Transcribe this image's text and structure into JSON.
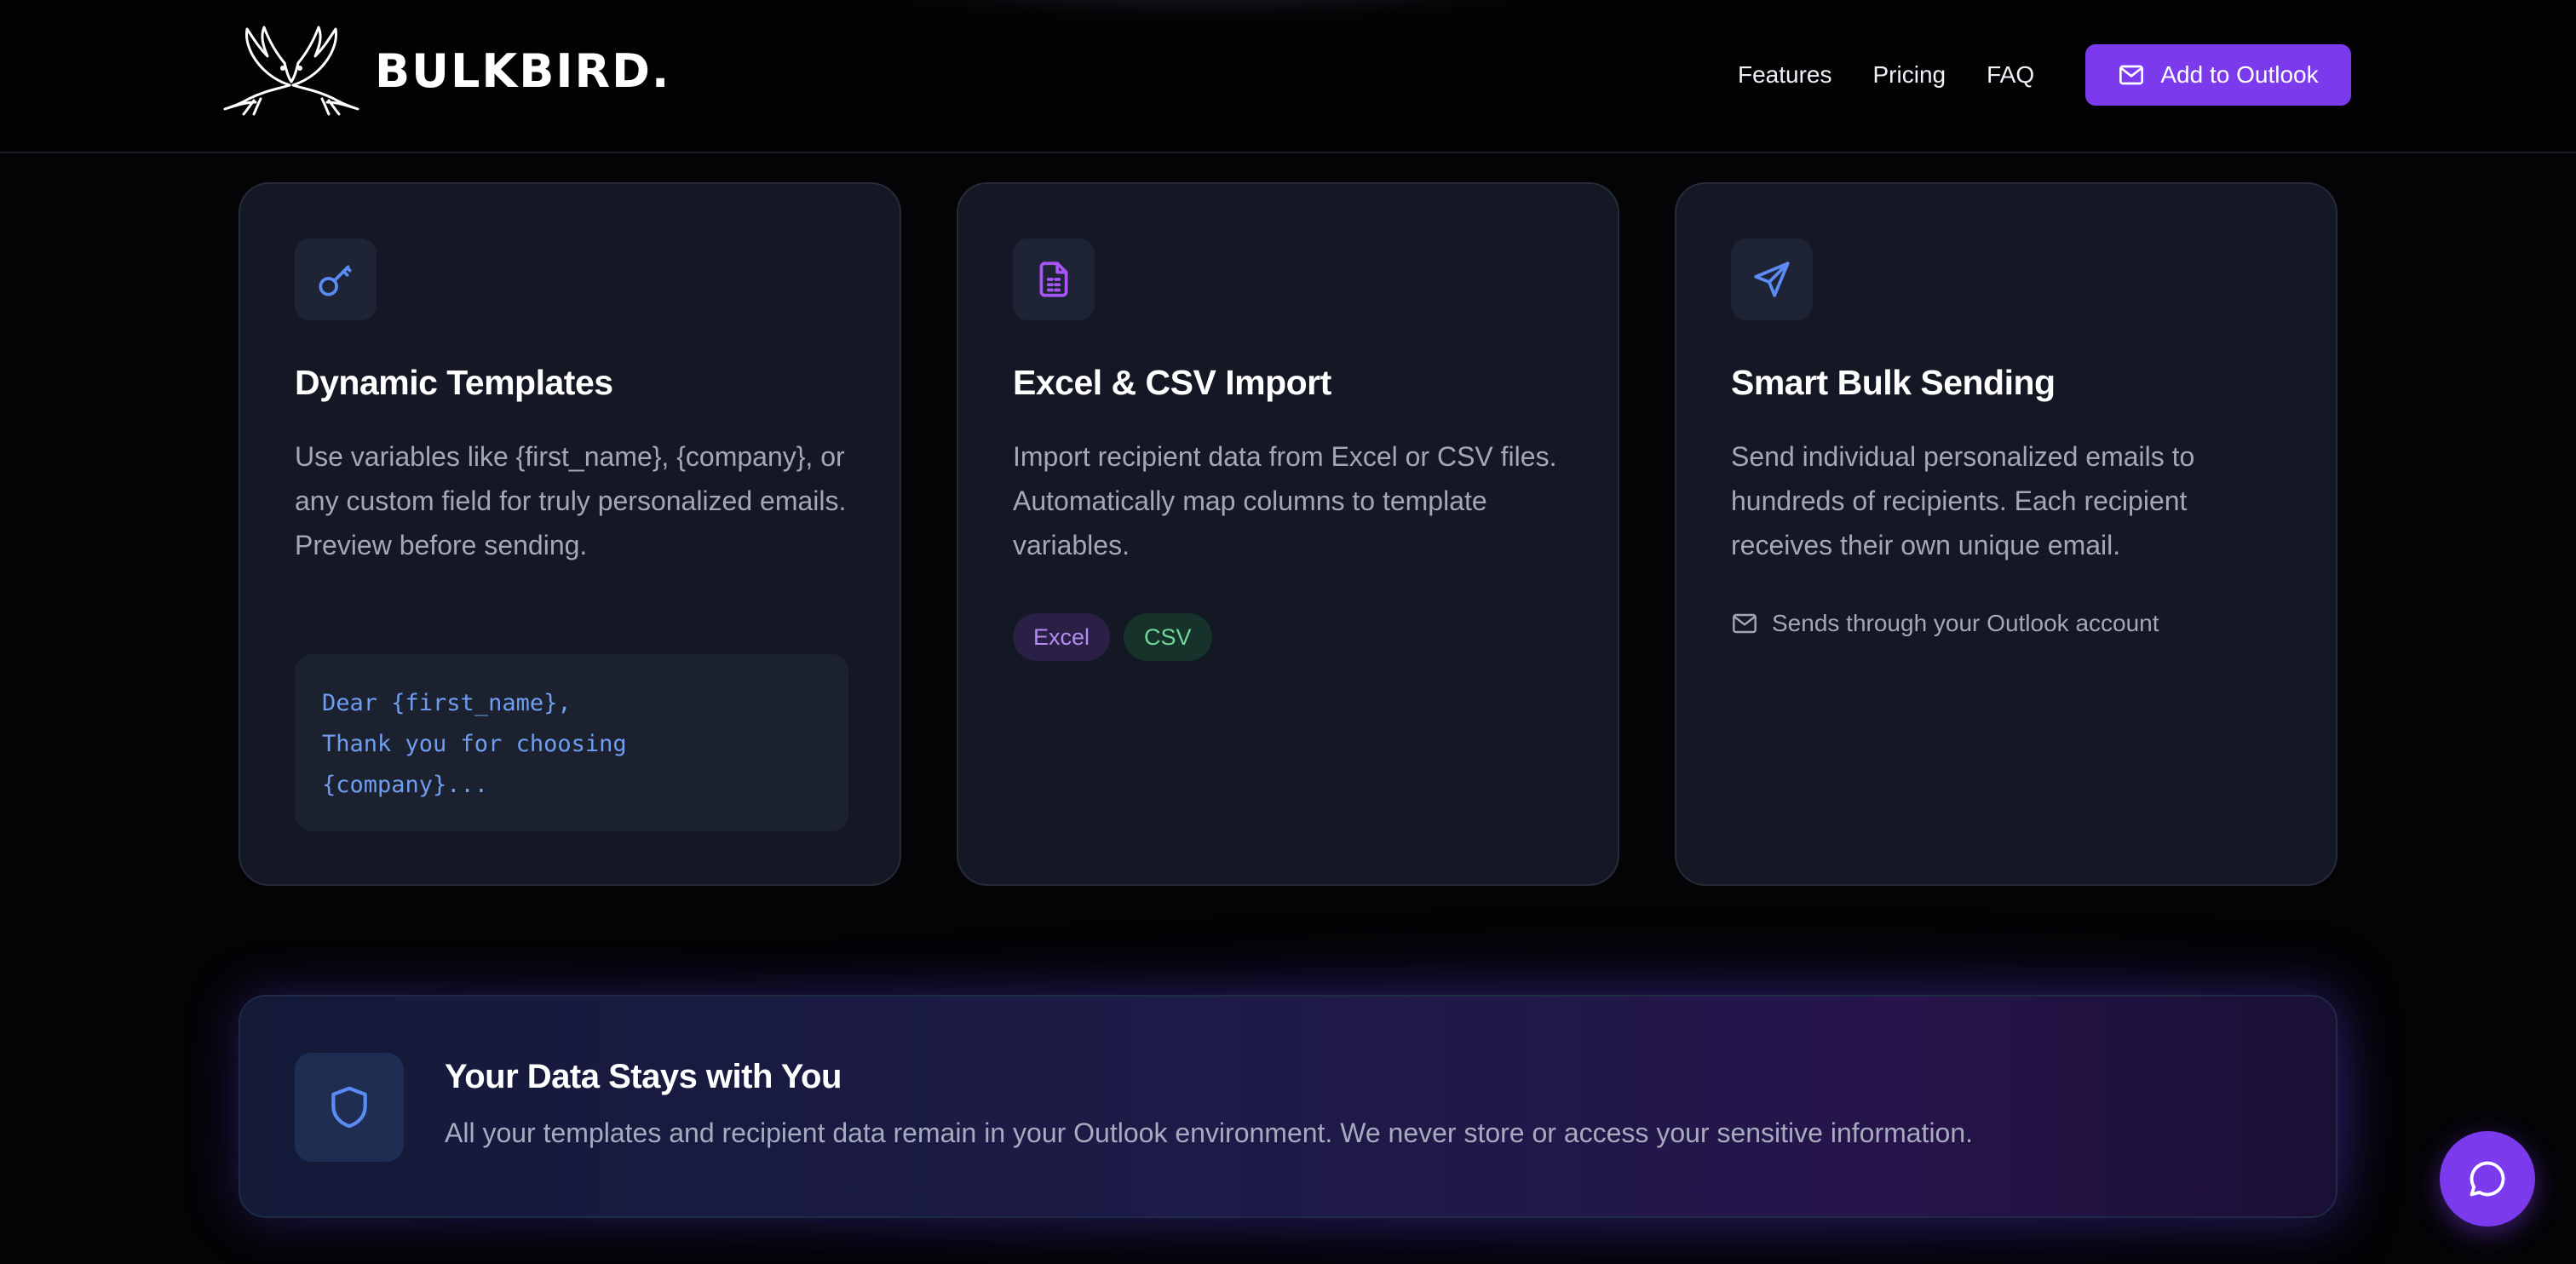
{
  "brand": {
    "name": "BULKBIRD.",
    "logo_icon": "doves-logo-icon"
  },
  "nav": {
    "links": [
      "Features",
      "Pricing",
      "FAQ"
    ],
    "cta_label": "Add to Outlook",
    "cta_icon": "mail-icon"
  },
  "features": [
    {
      "icon": "key-icon",
      "title": "Dynamic Templates",
      "description": "Use variables like {first_name}, {company}, or any custom field for truly personalized emails. Preview before sending.",
      "code_lines": [
        "Dear {first_name},",
        "Thank you for choosing",
        "{company}..."
      ]
    },
    {
      "icon": "file-spreadsheet-icon",
      "title": "Excel & CSV Import",
      "description": "Import recipient data from Excel or CSV files. Automatically map columns to template variables.",
      "tags": [
        "Excel",
        "CSV"
      ]
    },
    {
      "icon": "send-icon",
      "title": "Smart Bulk Sending",
      "description": "Send individual personalized emails to hundreds of recipients. Each recipient receives their own unique email.",
      "note": "Sends through your Outlook account",
      "note_icon": "mail-icon"
    }
  ],
  "privacy": {
    "icon": "shield-icon",
    "title": "Your Data Stays with You",
    "text": "All your templates and recipient data remain in your Outlook environment. We never store or access your sensitive information."
  },
  "chat": {
    "icon": "chat-bubble-icon"
  },
  "colors": {
    "accent": "#7c3aed",
    "background": "#040406",
    "card": "#141824",
    "code_text": "#6f9ef0",
    "excel_tag": "#b48cf0",
    "csv_tag": "#6fd69a"
  }
}
